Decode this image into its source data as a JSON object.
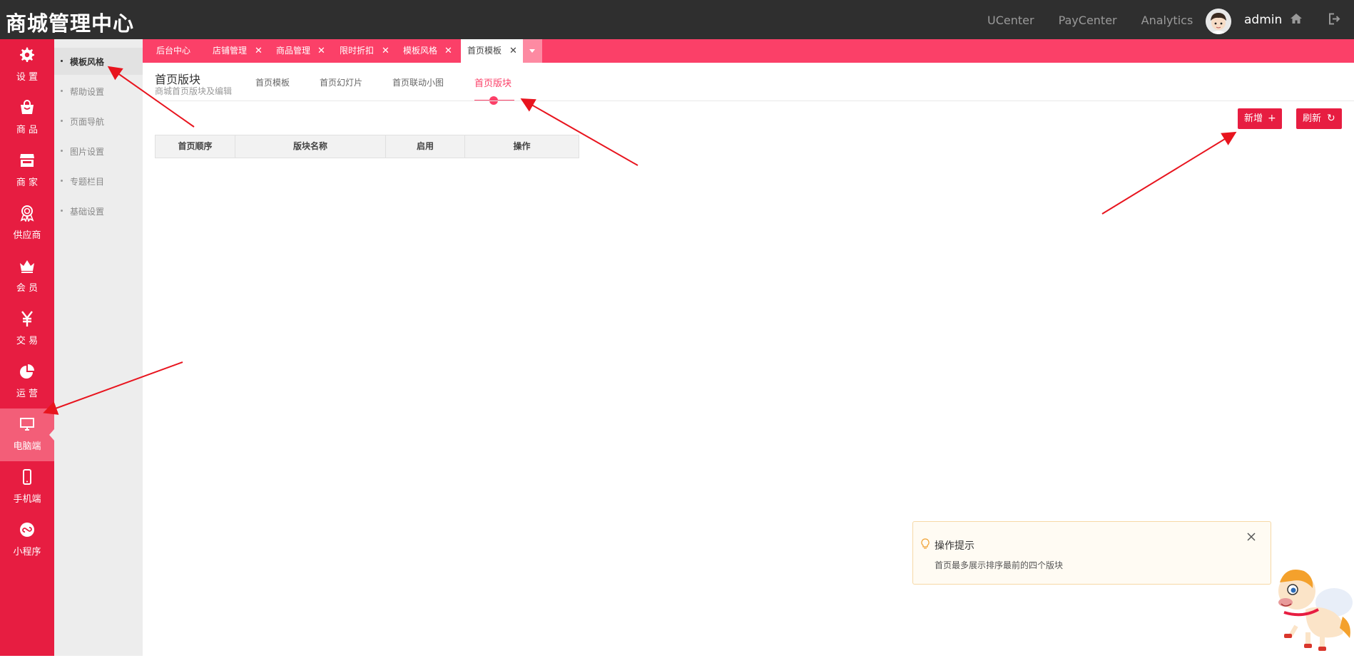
{
  "header": {
    "logo": "商城管理中心",
    "links": [
      "UCenter",
      "PayCenter",
      "Analytics"
    ],
    "username": "admin"
  },
  "sidebar": {
    "items": [
      {
        "label": "设 置",
        "icon": "gear-icon"
      },
      {
        "label": "商 品",
        "icon": "shopping-bag-icon"
      },
      {
        "label": "商 家",
        "icon": "store-icon"
      },
      {
        "label": "供应商",
        "icon": "award-icon"
      },
      {
        "label": "会 员",
        "icon": "crown-icon"
      },
      {
        "label": "交 易",
        "icon": "yen-icon"
      },
      {
        "label": "运 营",
        "icon": "pie-chart-icon"
      },
      {
        "label": "电脑端",
        "icon": "monitor-icon",
        "active": true
      },
      {
        "label": "手机端",
        "icon": "phone-icon"
      },
      {
        "label": "小程序",
        "icon": "miniprogram-icon"
      }
    ]
  },
  "subnav": {
    "items": [
      {
        "label": "模板风格",
        "active": true
      },
      {
        "label": "帮助设置"
      },
      {
        "label": "页面导航"
      },
      {
        "label": "图片设置"
      },
      {
        "label": "专题栏目"
      },
      {
        "label": "基础设置"
      }
    ]
  },
  "tabs": [
    {
      "label": "后台中心",
      "closable": false
    },
    {
      "label": "店铺管理",
      "closable": true
    },
    {
      "label": "商品管理",
      "closable": true
    },
    {
      "label": "限时折扣",
      "closable": true
    },
    {
      "label": "模板风格",
      "closable": true
    },
    {
      "label": "首页模板",
      "closable": true,
      "active": true
    }
  ],
  "tab_close_glyph": "✕",
  "page": {
    "title": "首页版块",
    "subtitle": "商城首页版块及编辑",
    "subtabs": [
      {
        "label": "首页模板"
      },
      {
        "label": "首页幻灯片"
      },
      {
        "label": "首页联动小图"
      },
      {
        "label": "首页版块",
        "active": true
      }
    ]
  },
  "buttons": {
    "add_label": "新增",
    "add_icon": "+",
    "refresh_label": "刷新",
    "refresh_icon": "↻"
  },
  "table": {
    "columns": [
      "首页顺序",
      "版块名称",
      "启用",
      "操作"
    ],
    "rows": []
  },
  "tip": {
    "title": "操作提示",
    "text": "首页最多展示排序最前的四个版块"
  },
  "colors": {
    "primary": "#e71d41",
    "tabstrip": "#fb4068",
    "topbar": "#2f2f2f",
    "annotation_arrow": "#e8141e"
  }
}
